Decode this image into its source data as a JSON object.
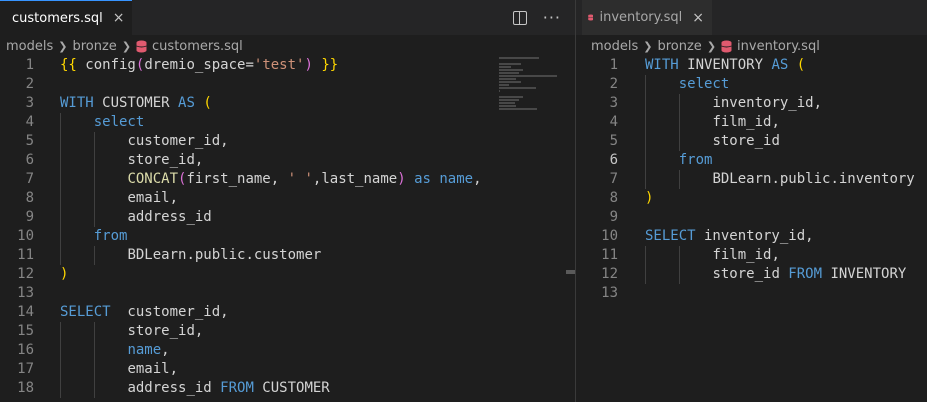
{
  "left": {
    "tab_title": "customers.sql",
    "close_glyph": "×",
    "breadcrumb": [
      "models",
      "bronze",
      "customers.sql"
    ],
    "lines": [
      {
        "n": "1",
        "indent": 0,
        "tokens": [
          [
            "{{",
            "b1"
          ],
          [
            " config",
            "id"
          ],
          [
            "(",
            "b2"
          ],
          [
            "dremio_space=",
            "id"
          ],
          [
            "'test'",
            "s"
          ],
          [
            ")",
            "b2"
          ],
          [
            " ",
            "id"
          ],
          [
            "}}",
            "b1"
          ]
        ]
      },
      {
        "n": "2",
        "indent": 0,
        "tokens": []
      },
      {
        "n": "3",
        "indent": 0,
        "tokens": [
          [
            "WITH",
            "k"
          ],
          [
            " CUSTOMER ",
            "id"
          ],
          [
            "AS",
            "k"
          ],
          [
            " ",
            "id"
          ],
          [
            "(",
            "b1"
          ]
        ]
      },
      {
        "n": "4",
        "indent": 1,
        "tokens": [
          [
            "select",
            "k"
          ]
        ]
      },
      {
        "n": "5",
        "indent": 2,
        "tokens": [
          [
            "customer_id,",
            "id"
          ]
        ]
      },
      {
        "n": "6",
        "indent": 2,
        "tokens": [
          [
            "store_id,",
            "id"
          ]
        ]
      },
      {
        "n": "7",
        "indent": 2,
        "tokens": [
          [
            "CONCAT",
            "f"
          ],
          [
            "(",
            "b2"
          ],
          [
            "first_name, ",
            "id"
          ],
          [
            "' '",
            "s"
          ],
          [
            ",last_name",
            "id"
          ],
          [
            ")",
            "b2"
          ],
          [
            " ",
            "id"
          ],
          [
            "as",
            "k"
          ],
          [
            " ",
            "id"
          ],
          [
            "name",
            "k"
          ],
          [
            ",",
            "id"
          ]
        ]
      },
      {
        "n": "8",
        "indent": 2,
        "tokens": [
          [
            "email,",
            "id"
          ]
        ]
      },
      {
        "n": "9",
        "indent": 2,
        "tokens": [
          [
            "address_id",
            "id"
          ]
        ]
      },
      {
        "n": "10",
        "indent": 1,
        "tokens": [
          [
            "from",
            "k"
          ]
        ]
      },
      {
        "n": "11",
        "indent": 2,
        "tokens": [
          [
            "BDLearn.public.customer",
            "id"
          ]
        ]
      },
      {
        "n": "12",
        "indent": 0,
        "tokens": [
          [
            ")",
            "b1"
          ]
        ]
      },
      {
        "n": "13",
        "indent": 0,
        "tokens": []
      },
      {
        "n": "14",
        "indent": 0,
        "tokens": [
          [
            "SELECT",
            "k"
          ],
          [
            "  customer_id,",
            "id"
          ]
        ]
      },
      {
        "n": "15",
        "indent": 2,
        "tokens": [
          [
            "store_id,",
            "id"
          ]
        ]
      },
      {
        "n": "16",
        "indent": 2,
        "tokens": [
          [
            "name",
            "k"
          ],
          [
            ",",
            "id"
          ]
        ]
      },
      {
        "n": "17",
        "indent": 2,
        "tokens": [
          [
            "email,",
            "id"
          ]
        ]
      },
      {
        "n": "18",
        "indent": 2,
        "tokens": [
          [
            "address_id ",
            "id"
          ],
          [
            "FROM",
            "k"
          ],
          [
            " CUSTOMER",
            "id"
          ]
        ]
      }
    ]
  },
  "right": {
    "tab_title": "inventory.sql",
    "close_glyph": "×",
    "breadcrumb": [
      "models",
      "bronze",
      "inventory.sql"
    ],
    "current_line": "6",
    "lines": [
      {
        "n": "1",
        "indent": 0,
        "tokens": [
          [
            "WITH",
            "k"
          ],
          [
            " INVENTORY ",
            "id"
          ],
          [
            "AS",
            "k"
          ],
          [
            " ",
            "id"
          ],
          [
            "(",
            "b1"
          ]
        ]
      },
      {
        "n": "2",
        "indent": 1,
        "tokens": [
          [
            "select",
            "k"
          ]
        ]
      },
      {
        "n": "3",
        "indent": 2,
        "tokens": [
          [
            "inventory_id,",
            "id"
          ]
        ]
      },
      {
        "n": "4",
        "indent": 2,
        "tokens": [
          [
            "film_id,",
            "id"
          ]
        ]
      },
      {
        "n": "5",
        "indent": 2,
        "tokens": [
          [
            "store_id",
            "id"
          ]
        ]
      },
      {
        "n": "6",
        "indent": 1,
        "tokens": [
          [
            "from",
            "k"
          ]
        ]
      },
      {
        "n": "7",
        "indent": 2,
        "tokens": [
          [
            "BDLearn.public.inventory",
            "id"
          ]
        ]
      },
      {
        "n": "8",
        "indent": 0,
        "tokens": [
          [
            ")",
            "b1"
          ]
        ]
      },
      {
        "n": "9",
        "indent": 0,
        "tokens": []
      },
      {
        "n": "10",
        "indent": 0,
        "tokens": [
          [
            "SELECT",
            "k"
          ],
          [
            " inventory_id,",
            "id"
          ]
        ]
      },
      {
        "n": "11",
        "indent": 2,
        "tokens": [
          [
            "film_id,",
            "id"
          ]
        ]
      },
      {
        "n": "12",
        "indent": 2,
        "tokens": [
          [
            "store_id ",
            "id"
          ],
          [
            "FROM",
            "k"
          ],
          [
            " INVENTORY",
            "id"
          ]
        ]
      },
      {
        "n": "13",
        "indent": 0,
        "tokens": []
      }
    ]
  },
  "icons": {
    "file_icon": "database-icon",
    "split_editor": "split-editor-icon",
    "more_actions": "more-actions-icon",
    "breadcrumb_separator": "chevron-right-icon"
  },
  "colors": {
    "keyword": "#569cd6",
    "function": "#dcdcaa",
    "string": "#ce9178",
    "bracket_level1": "#ffd700",
    "bracket_level2": "#da70d6",
    "db_icon": "#e05a6f"
  }
}
